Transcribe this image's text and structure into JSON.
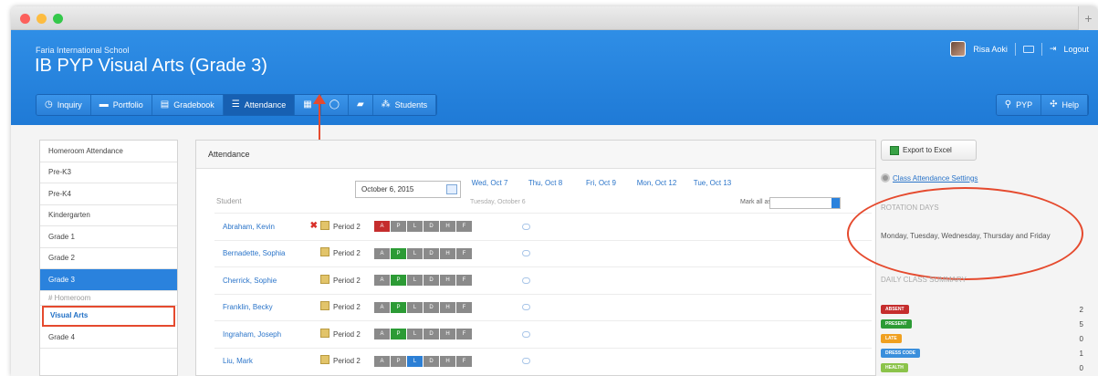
{
  "window": {
    "new_tab_symbol": "+"
  },
  "header": {
    "school": "Faria International School",
    "course": "IB PYP Visual Arts (Grade 3)",
    "user_name": "Risa Aoki",
    "logout": "Logout"
  },
  "nav": {
    "items": [
      {
        "label": "Inquiry",
        "icon": "clock-icon",
        "glyph": "◷"
      },
      {
        "label": "Portfolio",
        "icon": "briefcase-icon",
        "glyph": "▬"
      },
      {
        "label": "Gradebook",
        "icon": "gradebook-icon",
        "glyph": "▤"
      },
      {
        "label": "Attendance",
        "icon": "list-icon",
        "glyph": "☰"
      },
      {
        "label": "",
        "icon": "calendar-icon",
        "glyph": "▦"
      },
      {
        "label": "",
        "icon": "chat-icon",
        "glyph": "◯"
      },
      {
        "label": "",
        "icon": "folder-icon",
        "glyph": "▰"
      },
      {
        "label": "Students",
        "icon": "users-icon",
        "glyph": "⁂"
      }
    ],
    "right": [
      {
        "label": "PYP",
        "icon": "search-icon",
        "glyph": "⚲"
      },
      {
        "label": "Help",
        "icon": "help-icon",
        "glyph": "✣"
      }
    ]
  },
  "sidebar": {
    "items": [
      {
        "label": "Homeroom Attendance"
      },
      {
        "label": "Pre-K3"
      },
      {
        "label": "Pre-K4"
      },
      {
        "label": "Kindergarten"
      },
      {
        "label": "Grade 1"
      },
      {
        "label": "Grade 2"
      },
      {
        "label": "Grade 3"
      },
      {
        "label": "# Homeroom"
      },
      {
        "label": "Visual Arts"
      },
      {
        "label": "Grade 4"
      }
    ]
  },
  "main": {
    "title": "Attendance",
    "date_value": "October 6, 2015",
    "days": [
      "Wed, Oct 7",
      "Thu, Oct 8",
      "Fri, Oct 9",
      "Mon, Oct 12",
      "Tue, Oct 13"
    ],
    "subline": "Tuesday, October 6",
    "mark_all_label": "Mark all as:",
    "student_col": "Student",
    "codes": [
      "A",
      "P",
      "L",
      "D",
      "H",
      "F"
    ],
    "students": [
      {
        "name": "Abraham, Kevin",
        "period": "Period 2",
        "status": "A",
        "flag": true
      },
      {
        "name": "Bernadette, Sophia",
        "period": "Period 2",
        "status": "P",
        "flag": false
      },
      {
        "name": "Cherrick, Sophie",
        "period": "Period 2",
        "status": "P",
        "flag": false
      },
      {
        "name": "Franklin, Becky",
        "period": "Period 2",
        "status": "P",
        "flag": false
      },
      {
        "name": "Ingraham, Joseph",
        "period": "Period 2",
        "status": "P",
        "flag": false
      },
      {
        "name": "Liu, Mark",
        "period": "Period 2",
        "status": "L",
        "flag": false
      }
    ]
  },
  "right": {
    "export": "Export to Excel",
    "settings": "Class Attendance Settings",
    "rotation_title": "ROTATION DAYS",
    "rotation_days": "Monday, Tuesday, Wednesday, Thursday and Friday",
    "summary_title": "DAILY CLASS SUMMARY",
    "summary": [
      {
        "label": "ABSENT",
        "count": "2",
        "color": "#c52d2d"
      },
      {
        "label": "PRESENT",
        "count": "5",
        "color": "#2c9b35"
      },
      {
        "label": "LATE",
        "count": "0",
        "color": "#f0a020"
      },
      {
        "label": "DRESS CODE",
        "count": "1",
        "color": "#3a8fdc"
      },
      {
        "label": "HEALTH",
        "count": "0",
        "color": "#8bc34a"
      }
    ]
  }
}
